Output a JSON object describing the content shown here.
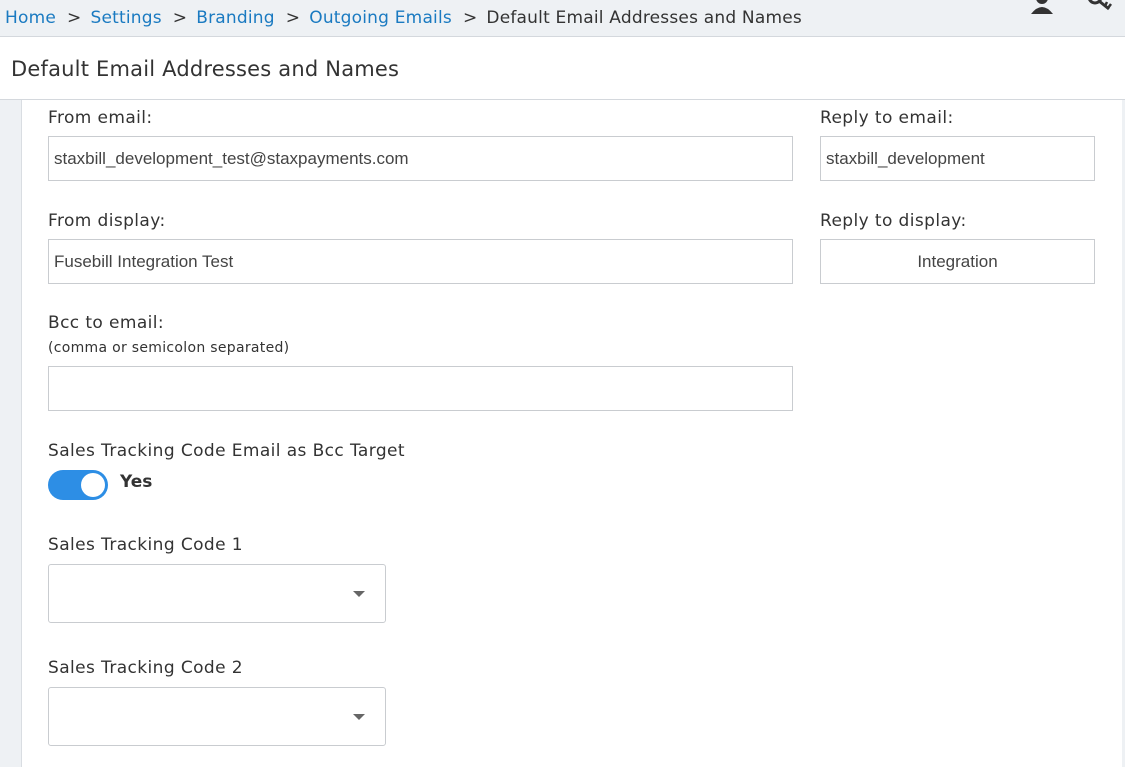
{
  "breadcrumb": {
    "items": [
      "Home",
      "Settings",
      "Branding",
      "Outgoing Emails"
    ],
    "current": "Default Email Addresses and Names",
    "separator": ">"
  },
  "topbar_icons": [
    "user-icon",
    "key-icon"
  ],
  "page_title": "Default Email Addresses and Names",
  "form": {
    "from_email": {
      "label": "From email:",
      "value": "staxbill_development_test@staxpayments.com"
    },
    "reply_to_email": {
      "label": "Reply to email:",
      "value": "staxbill_development"
    },
    "from_display": {
      "label": "From display:",
      "value": "Fusebill Integration Test"
    },
    "reply_to_display": {
      "label": "Reply to display:",
      "value": "Integration"
    },
    "bcc_email": {
      "label": "Bcc to email:",
      "hint": "(comma or semicolon separated)",
      "value": ""
    },
    "sales_tracking_bcc": {
      "label": "Sales Tracking Code Email as Bcc Target",
      "toggle_label": "Yes",
      "enabled": true
    },
    "sales_tracking_code_1": {
      "label": "Sales Tracking Code 1",
      "selected": ""
    },
    "sales_tracking_code_2": {
      "label": "Sales Tracking Code 2",
      "selected": ""
    }
  },
  "colors": {
    "link": "#1a7ac1",
    "toggle_on": "#2d8ee5",
    "background": "#eef1f4"
  }
}
